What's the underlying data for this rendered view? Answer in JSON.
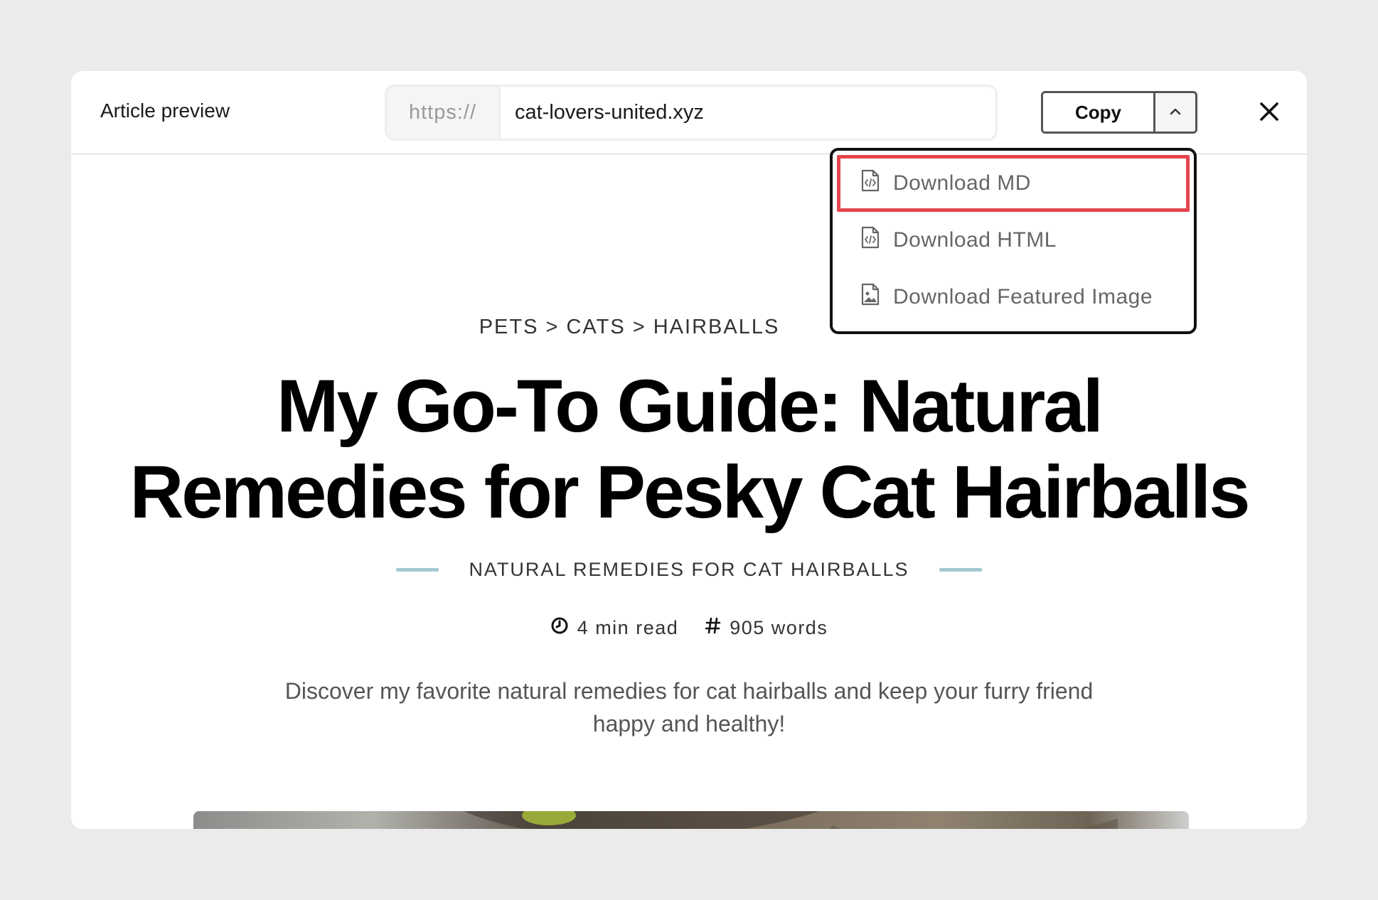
{
  "header": {
    "title": "Article preview",
    "url_prefix": "https://",
    "url_value": "cat-lovers-united.xyz",
    "copy_label": "Copy"
  },
  "dropdown": {
    "items": [
      {
        "label": "Download MD",
        "icon": "file-code-icon",
        "highlighted": true
      },
      {
        "label": "Download HTML",
        "icon": "file-code-icon",
        "highlighted": false
      },
      {
        "label": "Download Featured Image",
        "icon": "file-image-icon",
        "highlighted": false
      }
    ]
  },
  "article": {
    "breadcrumb": "PETS > CATS > HAIRBALLS",
    "title_line1": "My Go-To Guide: Natural",
    "title_line2": "Remedies for Pesky Cat Hairballs",
    "subtitle": "NATURAL REMEDIES FOR CAT HAIRBALLS",
    "read_time": "4 min read",
    "word_count": "905 words",
    "description": "Discover my favorite natural remedies for cat hairballs and keep your furry friend happy and healthy!"
  },
  "colors": {
    "accent_line": "#a3c9d1",
    "highlight_border": "#e4454f"
  }
}
